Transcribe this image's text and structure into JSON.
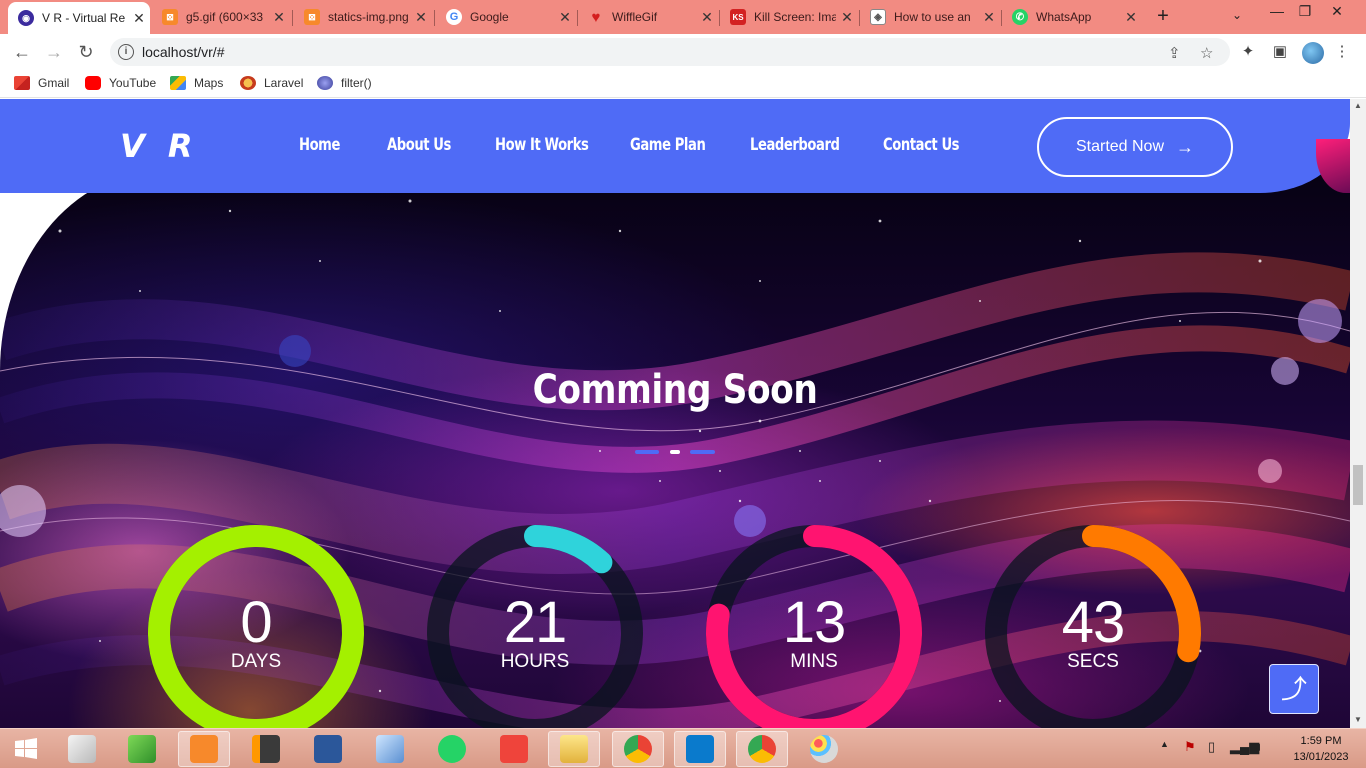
{
  "browser": {
    "tabs": [
      {
        "title": "V R - Virtual Re",
        "active": true,
        "icon": "site-favicon"
      },
      {
        "title": "g5.gif (600×33",
        "icon": "xampp-favicon"
      },
      {
        "title": "statics-img.png",
        "icon": "xampp-favicon"
      },
      {
        "title": "Google",
        "icon": "google-favicon"
      },
      {
        "title": "WiffleGif",
        "icon": "heart-favicon"
      },
      {
        "title": "Kill Screen: Ima",
        "icon": "ks-favicon"
      },
      {
        "title": "How to use an",
        "icon": "diamond-favicon"
      },
      {
        "title": "WhatsApp",
        "icon": "whatsapp-favicon"
      }
    ],
    "url": "localhost/vr/#",
    "bookmarks": [
      "Gmail",
      "YouTube",
      "Maps",
      "Laravel",
      "filter()"
    ]
  },
  "page": {
    "brand": "V R",
    "menu": [
      "Home",
      "About Us",
      "How It Works",
      "Game Plan",
      "Leaderboard",
      "Contact Us"
    ],
    "cta_label": "Started Now",
    "title": "Comming Soon",
    "counters": [
      {
        "value": "0",
        "unit": "DAYS",
        "color": "#a4f000",
        "progress": 1.0
      },
      {
        "value": "21",
        "unit": "HOURS",
        "color": "#2fd3db",
        "progress": 0.12
      },
      {
        "value": "13",
        "unit": "MINS",
        "color": "#ff1470",
        "progress": 0.78
      },
      {
        "value": "43",
        "unit": "SECS",
        "color": "#ff7a00",
        "progress": 0.28
      }
    ],
    "accent": "#4f6bf6"
  },
  "taskbar": {
    "time": "1:59 PM",
    "date": "13/01/2023"
  }
}
